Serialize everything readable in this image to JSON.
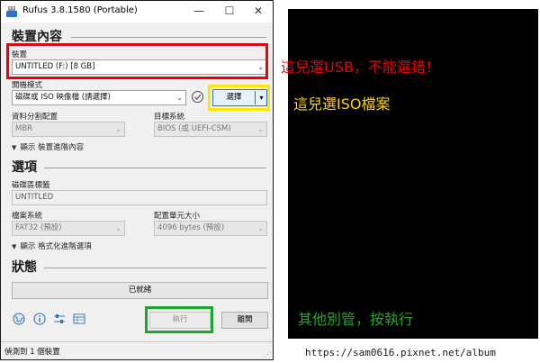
{
  "window": {
    "title": "Rufus 3.8.1580 (Portable)",
    "min_label": "—",
    "max_label": "☐",
    "close_label": "✕"
  },
  "device_section": {
    "heading": "裝置內容",
    "device_label": "裝置",
    "device_value": "UNTITLED (F:) [8 GB]",
    "boot_label": "開機模式",
    "boot_value": "磁碟或 ISO 映像檔 (請選擇)",
    "select_button": "選擇",
    "partition_label": "資料分割配置",
    "partition_value": "MBR",
    "target_label": "目標系統",
    "target_value": "BIOS (或 UEFI-CSM)",
    "advanced_toggle": "顯示 裝置進階內容"
  },
  "format_section": {
    "heading": "選項",
    "volume_label_label": "磁碟區標籤",
    "volume_label_value": "UNTITLED",
    "filesystem_label": "檔案系統",
    "filesystem_value": "FAT32 (預設)",
    "cluster_label": "配置單元大小",
    "cluster_value": "4096 bytes (預設)",
    "advanced_toggle": "顯示 格式化進階選項"
  },
  "status_section": {
    "heading": "狀態",
    "status_text": "已就緒"
  },
  "actions": {
    "start_button": "執行",
    "close_button": "離開"
  },
  "statusbar": {
    "text": "偵測到 1 個裝置"
  },
  "annotations": {
    "usb_note": "這兒選USB，不能選錯！",
    "iso_note": "這兒選ISO檔案",
    "start_note": "其他別管，按執行",
    "watermark": "https://sam0616.pixnet.net/album"
  },
  "colors": {
    "red": "#e8000b",
    "yellow": "#ffe600",
    "green": "#18a82a",
    "accent": "#2b6fd6"
  },
  "icons": [
    "rufus-usb-icon",
    "checkmark-circle-icon",
    "globe-icon",
    "info-icon",
    "settings-sliders-icon",
    "log-table-icon"
  ]
}
